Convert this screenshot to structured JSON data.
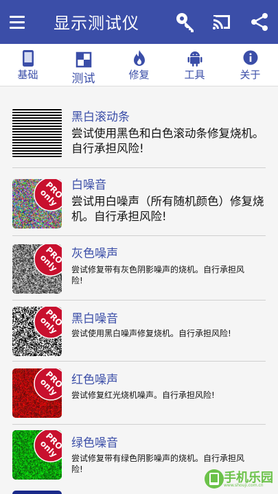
{
  "toolbar": {
    "title": "显示测试仪"
  },
  "tabs": [
    {
      "label": "基础",
      "icon": "phone-icon"
    },
    {
      "label": "测试",
      "icon": "checker-icon"
    },
    {
      "label": "修复",
      "icon": "flame-icon"
    },
    {
      "label": "工具",
      "icon": "android-icon"
    },
    {
      "label": "关于",
      "icon": "info-icon"
    }
  ],
  "items": [
    {
      "title": "黑白滚动条",
      "desc": "尝试使用黑色和白色滚动条修复烧机。自行承担风险!",
      "pro": false,
      "kind": "stripes"
    },
    {
      "title": "白噪音",
      "desc": "尝试用白噪声（所有随机颜色）修复烧机。自行承担风险!",
      "pro": true,
      "kind": "color-noise"
    },
    {
      "title": "灰色噪声",
      "desc": "尝试修复带有灰色阴影噪声的烧机。自行承担风险!",
      "pro": true,
      "kind": "gray-noise"
    },
    {
      "title": "黑白噪音",
      "desc": "尝试使用黑白噪声修复烧机。自行承担风险!",
      "pro": true,
      "kind": "bw-noise"
    },
    {
      "title": "红色噪声",
      "desc": "尝试修复红光烧机噪声。自行承担风险!",
      "pro": true,
      "kind": "red-noise"
    },
    {
      "title": "绿色噪音",
      "desc": "尝试修复带有绿色阴影噪声的烧机。自行承担风险!",
      "pro": true,
      "kind": "green-noise"
    }
  ],
  "ribbon": {
    "line1": "PRO",
    "line2": "only"
  },
  "watermark": {
    "text": "手机乐园",
    "sub": "www.shouji.com.cn"
  },
  "colors": {
    "primary": "#3b4ea8",
    "ribbon": "#c8102e",
    "accent": "#6cc24a"
  }
}
